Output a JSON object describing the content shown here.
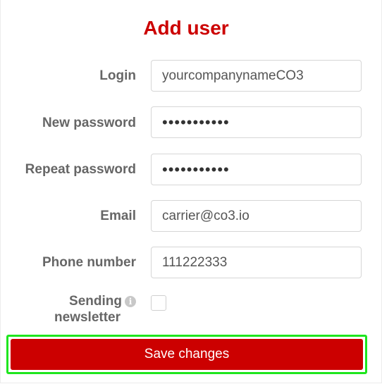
{
  "form": {
    "title": "Add user",
    "fields": {
      "login": {
        "label": "Login",
        "value": "yourcompanynameCO3"
      },
      "new_password": {
        "label": "New password",
        "value": "•••••••••••"
      },
      "repeat_password": {
        "label": "Repeat password",
        "value": "•••••••••••"
      },
      "email": {
        "label": "Email",
        "value": "carrier@co3.io"
      },
      "phone": {
        "label": "Phone number",
        "value": "111222333"
      }
    },
    "newsletter": {
      "label_line1": "Sending",
      "label_line2": "newsletter",
      "info_glyph": "i",
      "checked": false
    },
    "save_label": "Save changes"
  },
  "colors": {
    "accent": "#cc0000",
    "label": "#666666",
    "highlight": "#1ee61e"
  }
}
